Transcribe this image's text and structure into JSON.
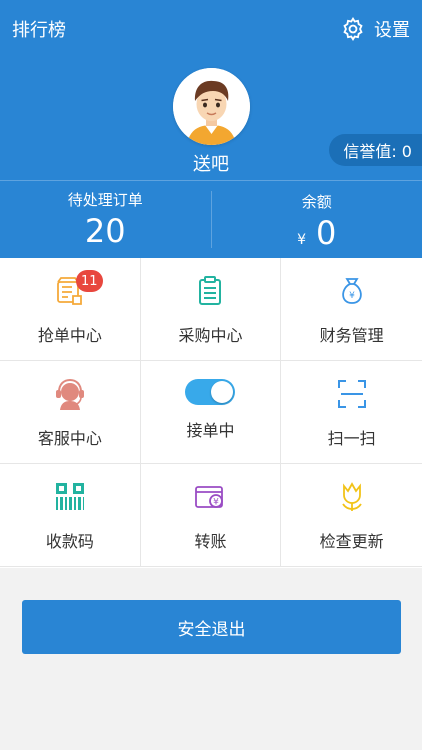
{
  "header": {
    "ranking_label": "排行榜",
    "settings_label": "设置",
    "username": "送吧",
    "credit_label": "信誉值: 0"
  },
  "stats": {
    "pending_orders_label": "待处理订单",
    "pending_orders_value": "20",
    "balance_label": "余额",
    "balance_currency": "¥",
    "balance_value": "0"
  },
  "grid": {
    "items": [
      {
        "label": "抢单中心",
        "badge": "11",
        "icon": "order-grab-icon",
        "color": "#f5a93a"
      },
      {
        "label": "采购中心",
        "icon": "clipboard-icon",
        "color": "#22b3a0"
      },
      {
        "label": "财务管理",
        "icon": "money-bag-icon",
        "color": "#3a95e6"
      },
      {
        "label": "客服中心",
        "icon": "headset-icon",
        "color": "#e0897e"
      },
      {
        "label": "接单中",
        "icon": "toggle-switch",
        "color": "#38a9ea"
      },
      {
        "label": "扫一扫",
        "icon": "scan-icon",
        "color": "#3a95e6"
      },
      {
        "label": "收款码",
        "icon": "qr-code-icon",
        "color": "#22b3a0"
      },
      {
        "label": "转账",
        "icon": "wallet-transfer-icon",
        "color": "#9a4cc4"
      },
      {
        "label": "检查更新",
        "icon": "tulip-icon",
        "color": "#f2c318"
      }
    ]
  },
  "footer": {
    "logout_label": "安全退出"
  },
  "colors": {
    "primary": "#2985d4",
    "badge": "#e8473e"
  }
}
